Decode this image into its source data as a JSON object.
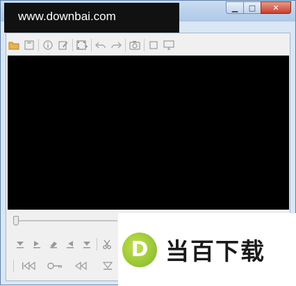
{
  "watermark": {
    "text": "www.downbai.com"
  },
  "window_controls": {
    "minimize": "▁",
    "maximize": "□",
    "close": "✕"
  },
  "toolbar": {
    "icons": [
      "open-folder-icon",
      "save-icon",
      "info-icon",
      "edit-icon",
      "film-add-icon",
      "undo-icon",
      "redo-icon",
      "camera-icon",
      "fullscreen-icon",
      "monitor-icon"
    ]
  },
  "logo": {
    "badge_letter": "D",
    "brand_text": "当百下载",
    "badge_color": "#8cc63f"
  }
}
